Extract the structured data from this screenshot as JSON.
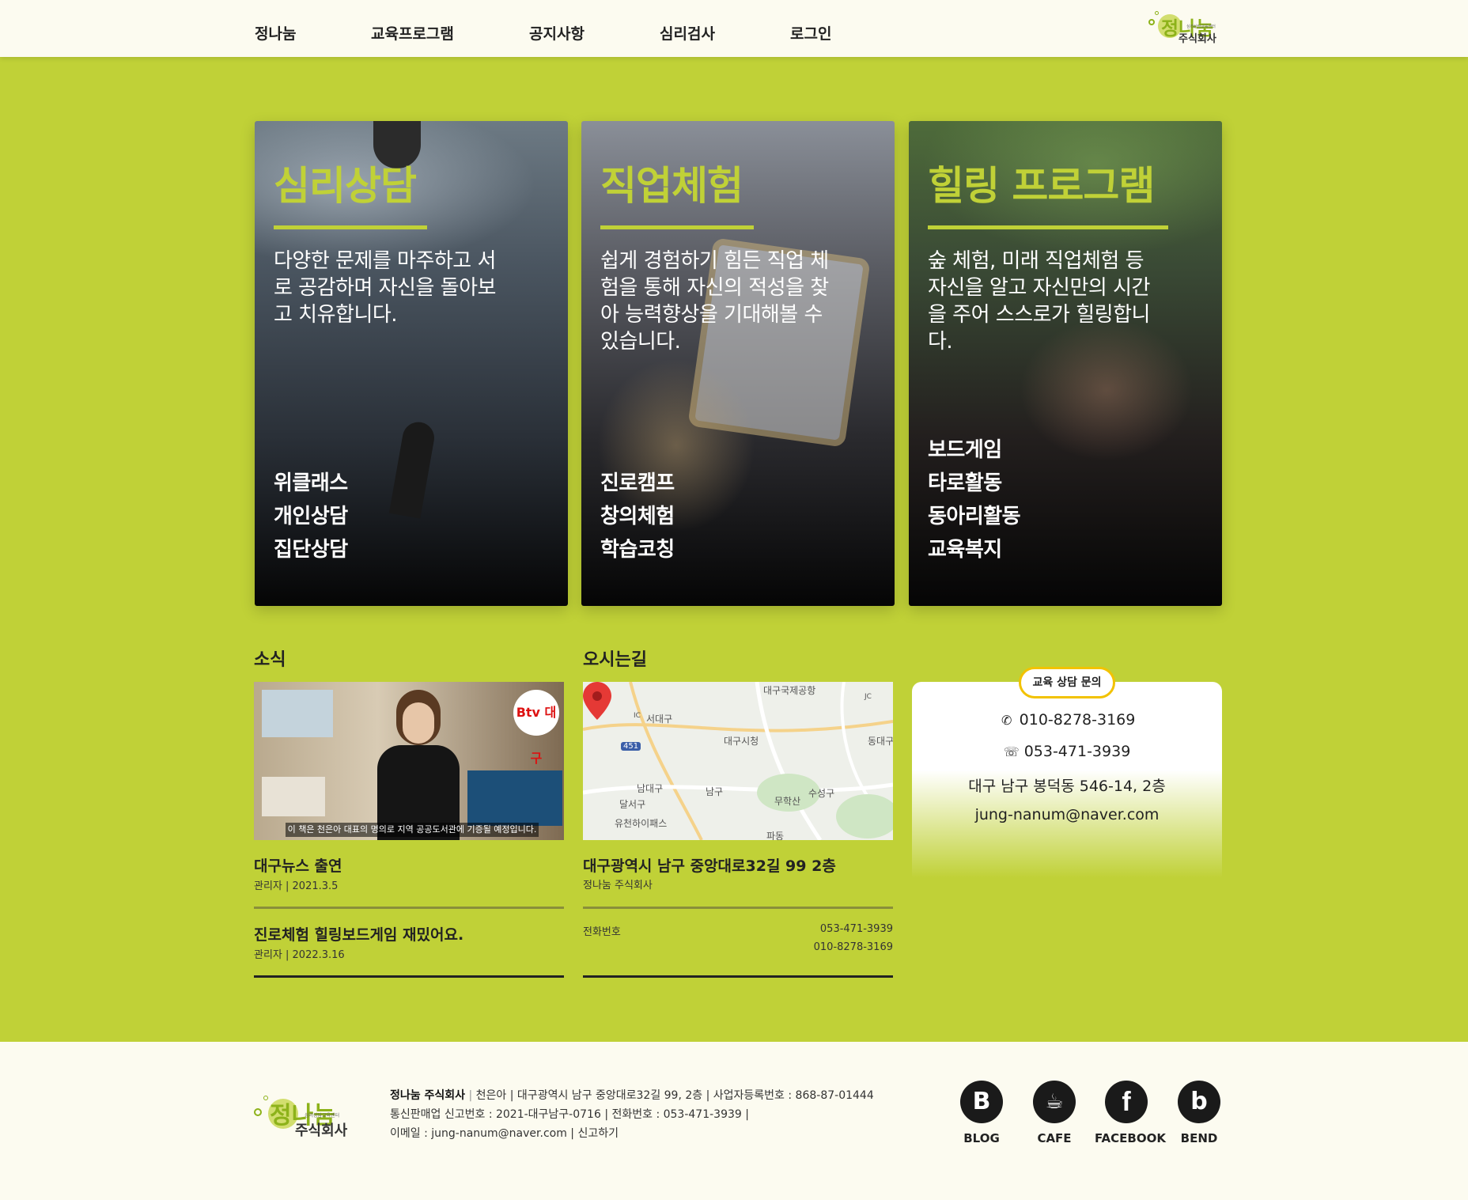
{
  "nav": {
    "items": [
      {
        "label": "정나눔"
      },
      {
        "label": "교육프로그램"
      },
      {
        "label": "공지사항"
      },
      {
        "label": "심리검사"
      },
      {
        "label": "로그인"
      }
    ],
    "logo": {
      "name": "정나눔",
      "sub": "주식회사",
      "tagline": "심리상담교육센터"
    }
  },
  "cards": [
    {
      "title": "심리상담",
      "desc": "다양한 문제를 마주하고 서로 공감하며 자신을 돌아보고 치유합니다.",
      "items": [
        "위클래스",
        "개인상담",
        "집단상담"
      ]
    },
    {
      "title": "직업체험",
      "desc": "쉽게 경험하기 힘든 직업 체험을 통해 자신의 적성을 찾아 능력향상을 기대해볼 수 있습니다.",
      "items": [
        "진로캠프",
        "창의체험",
        "학습코칭"
      ]
    },
    {
      "title": "힐링 프로그램",
      "desc": "숲 체험, 미래 직업체험 등 자신을 알고 자신만의 시간을 주어 스스로가 힐링합니다.",
      "items": [
        "보드게임",
        "타로활동",
        "동아리활동",
        "교육복지"
      ]
    }
  ],
  "news": {
    "title": "소식",
    "image_caption": "이 책은 천은아 대표의 명의로 지역 공공도서관에 기증될 예정입니다.",
    "image_badge": "Btv 대구",
    "items": [
      {
        "title": "대구뉴스 출연",
        "meta": "관리자 | 2021.3.5"
      },
      {
        "title": "진로체험 힐링보드게임 재밌어요.",
        "meta": "관리자 | 2022.3.16"
      }
    ]
  },
  "location": {
    "title": "오시는길",
    "address": "대구광역시 남구 중앙대로32길 99 2층",
    "company": "정나눔 주식회사",
    "tel_label": "전화번호",
    "tel1": "053-471-3939",
    "tel2": "010-8278-3169",
    "map_labels": [
      "대구국제공항",
      "서대구",
      "대구시청",
      "동대구",
      "남대구",
      "남구",
      "무학산",
      "수성구",
      "달서구",
      "유천하이패스",
      "파동",
      "451",
      "JC",
      "IC"
    ]
  },
  "contact": {
    "tag": "교육 상담 문의",
    "mobile": "010-8278-3169",
    "phone": "053-471-3939",
    "address": "대구 남구 봉덕동 546-14, 2층",
    "email": "jung-nanum@naver.com"
  },
  "footer": {
    "company": "정나눔 주식회사",
    "line1": "천은아  |  대구광역시 남구 중앙대로32길 99, 2층  |  사업자등록번호 : 868-87-01444",
    "line2": "통신판매업 신고번호 : 2021-대구남구-0716  |  전화번호 : 053-471-3939  |",
    "line3": "이메일 : jung-nanum@naver.com   |   신고하기",
    "social": [
      {
        "label": "BLOG",
        "glyph": "B"
      },
      {
        "label": "CAFE",
        "glyph": "☕"
      },
      {
        "label": "FACEBOOK",
        "glyph": "f"
      },
      {
        "label": "BEND",
        "glyph": "b"
      }
    ]
  },
  "colors": {
    "accent": "#c0d137",
    "cream": "#fcfbf0",
    "pin": "#e53935",
    "tag_border": "#f2c200"
  }
}
